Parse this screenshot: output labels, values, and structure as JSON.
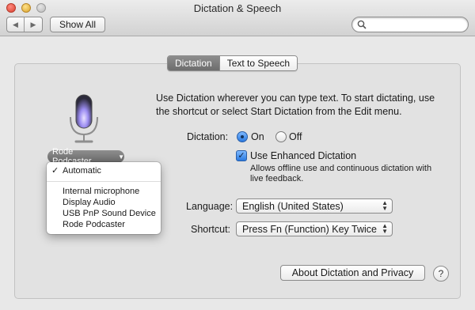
{
  "window": {
    "title": "Dictation & Speech"
  },
  "toolbar": {
    "back_icon": "chevron-left-icon",
    "forward_icon": "chevron-right-icon",
    "show_all_label": "Show All",
    "search_placeholder": "",
    "search_icon": "search-icon"
  },
  "tabs": [
    {
      "label": "Dictation",
      "active": true
    },
    {
      "label": "Text to Speech",
      "active": false
    }
  ],
  "microphone": {
    "icon": "microphone-icon",
    "source_label": "Rode Podcaster",
    "menu": {
      "selected": "Automatic",
      "items_top": [
        "Automatic"
      ],
      "items": [
        "Internal microphone",
        "Display Audio",
        "USB PnP Sound Device",
        "Rode Podcaster"
      ]
    }
  },
  "intro_text": "Use Dictation wherever you can type text. To start dictating, use the shortcut or select Start Dictation from the Edit menu.",
  "dictation": {
    "label": "Dictation:",
    "on_label": "On",
    "off_label": "Off",
    "selected": "On"
  },
  "enhanced": {
    "label": "Use Enhanced Dictation",
    "checked": true,
    "help": "Allows offline use and continuous dictation with live feedback."
  },
  "language": {
    "label": "Language:",
    "value": "English (United States)"
  },
  "shortcut": {
    "label": "Shortcut:",
    "value": "Press Fn (Function) Key Twice"
  },
  "about_button": "About Dictation and Privacy",
  "help_button": "?",
  "colors": {
    "accent_blue": "#2a79e0",
    "tab_active": "#7a7a7a",
    "panel_bg": "#e2e2e2"
  }
}
